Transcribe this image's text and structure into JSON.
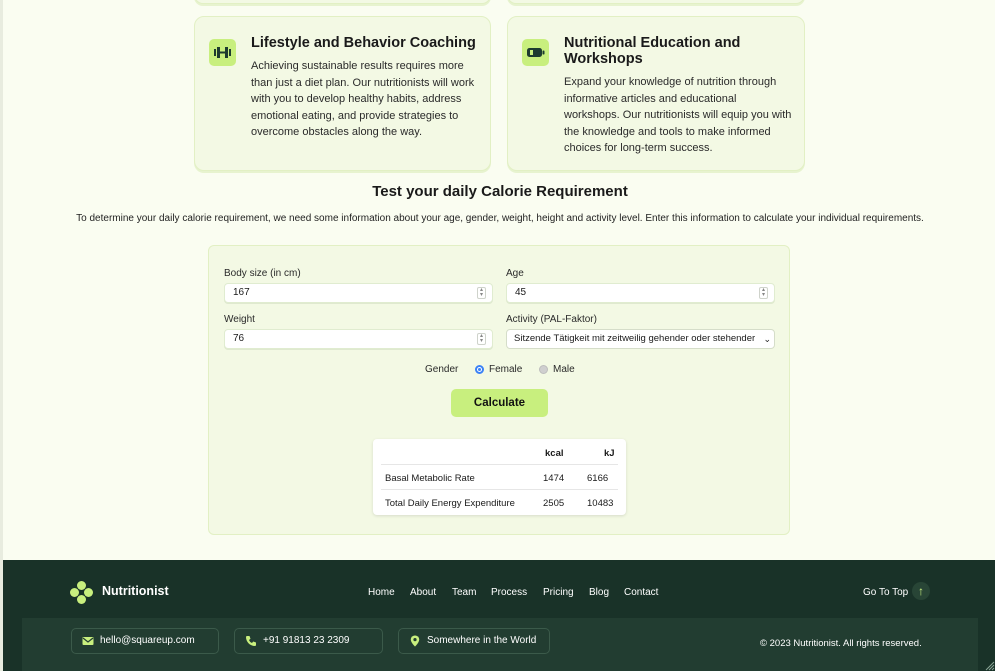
{
  "services": [
    {
      "title": "Lifestyle and Behavior Coaching",
      "description": "Achieving sustainable results requires more than just a diet plan. Our nutritionists will work with you to develop healthy habits, address emotional eating, and provide strategies to overcome obstacles along the way.",
      "icon": "dumbbell-icon"
    },
    {
      "title": "Nutritional Education and Workshops",
      "description": "Expand your knowledge of nutrition through informative articles and educational workshops. Our nutritionists will equip you with the knowledge and tools to make informed choices for long-term success.",
      "icon": "battery-icon"
    }
  ],
  "calculator": {
    "title": "Test your daily Calorie Requirement",
    "intro": "To determine your daily calorie requirement, we need some information about your age, gender, weight, height and activity level. Enter this information to calculate your individual requirements.",
    "body_size_label": "Body size (in cm)",
    "body_size_value": "167",
    "age_label": "Age",
    "age_value": "45",
    "weight_label": "Weight",
    "weight_value": "76",
    "activity_label": "Activity (PAL-Faktor)",
    "activity_value": "Sitzende Tätigkeit mit zeitweilig gehender oder stehender",
    "gender_label": "Gender",
    "gender_options": [
      "Female",
      "Male"
    ],
    "gender_selected": "Female",
    "calculate_label": "Calculate",
    "results": {
      "headers": [
        "kcal",
        "kJ"
      ],
      "rows": [
        {
          "label": "Basal Metabolic Rate",
          "kcal": "1474",
          "kj": "6166"
        },
        {
          "label": "Total Daily Energy Expenditure",
          "kcal": "2505",
          "kj": "10483"
        }
      ]
    }
  },
  "footer": {
    "brand": "Nutritionist",
    "nav": [
      "Home",
      "About",
      "Team",
      "Process",
      "Pricing",
      "Blog",
      "Contact"
    ],
    "go_to_top": "Go To Top",
    "go_to_top_icon": "↑",
    "contacts": [
      {
        "icon": "mail-icon",
        "text": "hello@squareup.com"
      },
      {
        "icon": "phone-icon",
        "text": "+91 91813 23 2309"
      },
      {
        "icon": "location-pin-icon",
        "text": "Somewhere in the World"
      }
    ],
    "copyright": "© 2023 Nutritionist. All rights reserved."
  },
  "colors": {
    "accent": "#c8ef7e",
    "page_bg": "#fafdf1",
    "card_bg": "#f3f9e4",
    "footer_bg": "#193228",
    "footer_sub_bg": "#223d31",
    "radio_selected": "#3b82f6"
  }
}
